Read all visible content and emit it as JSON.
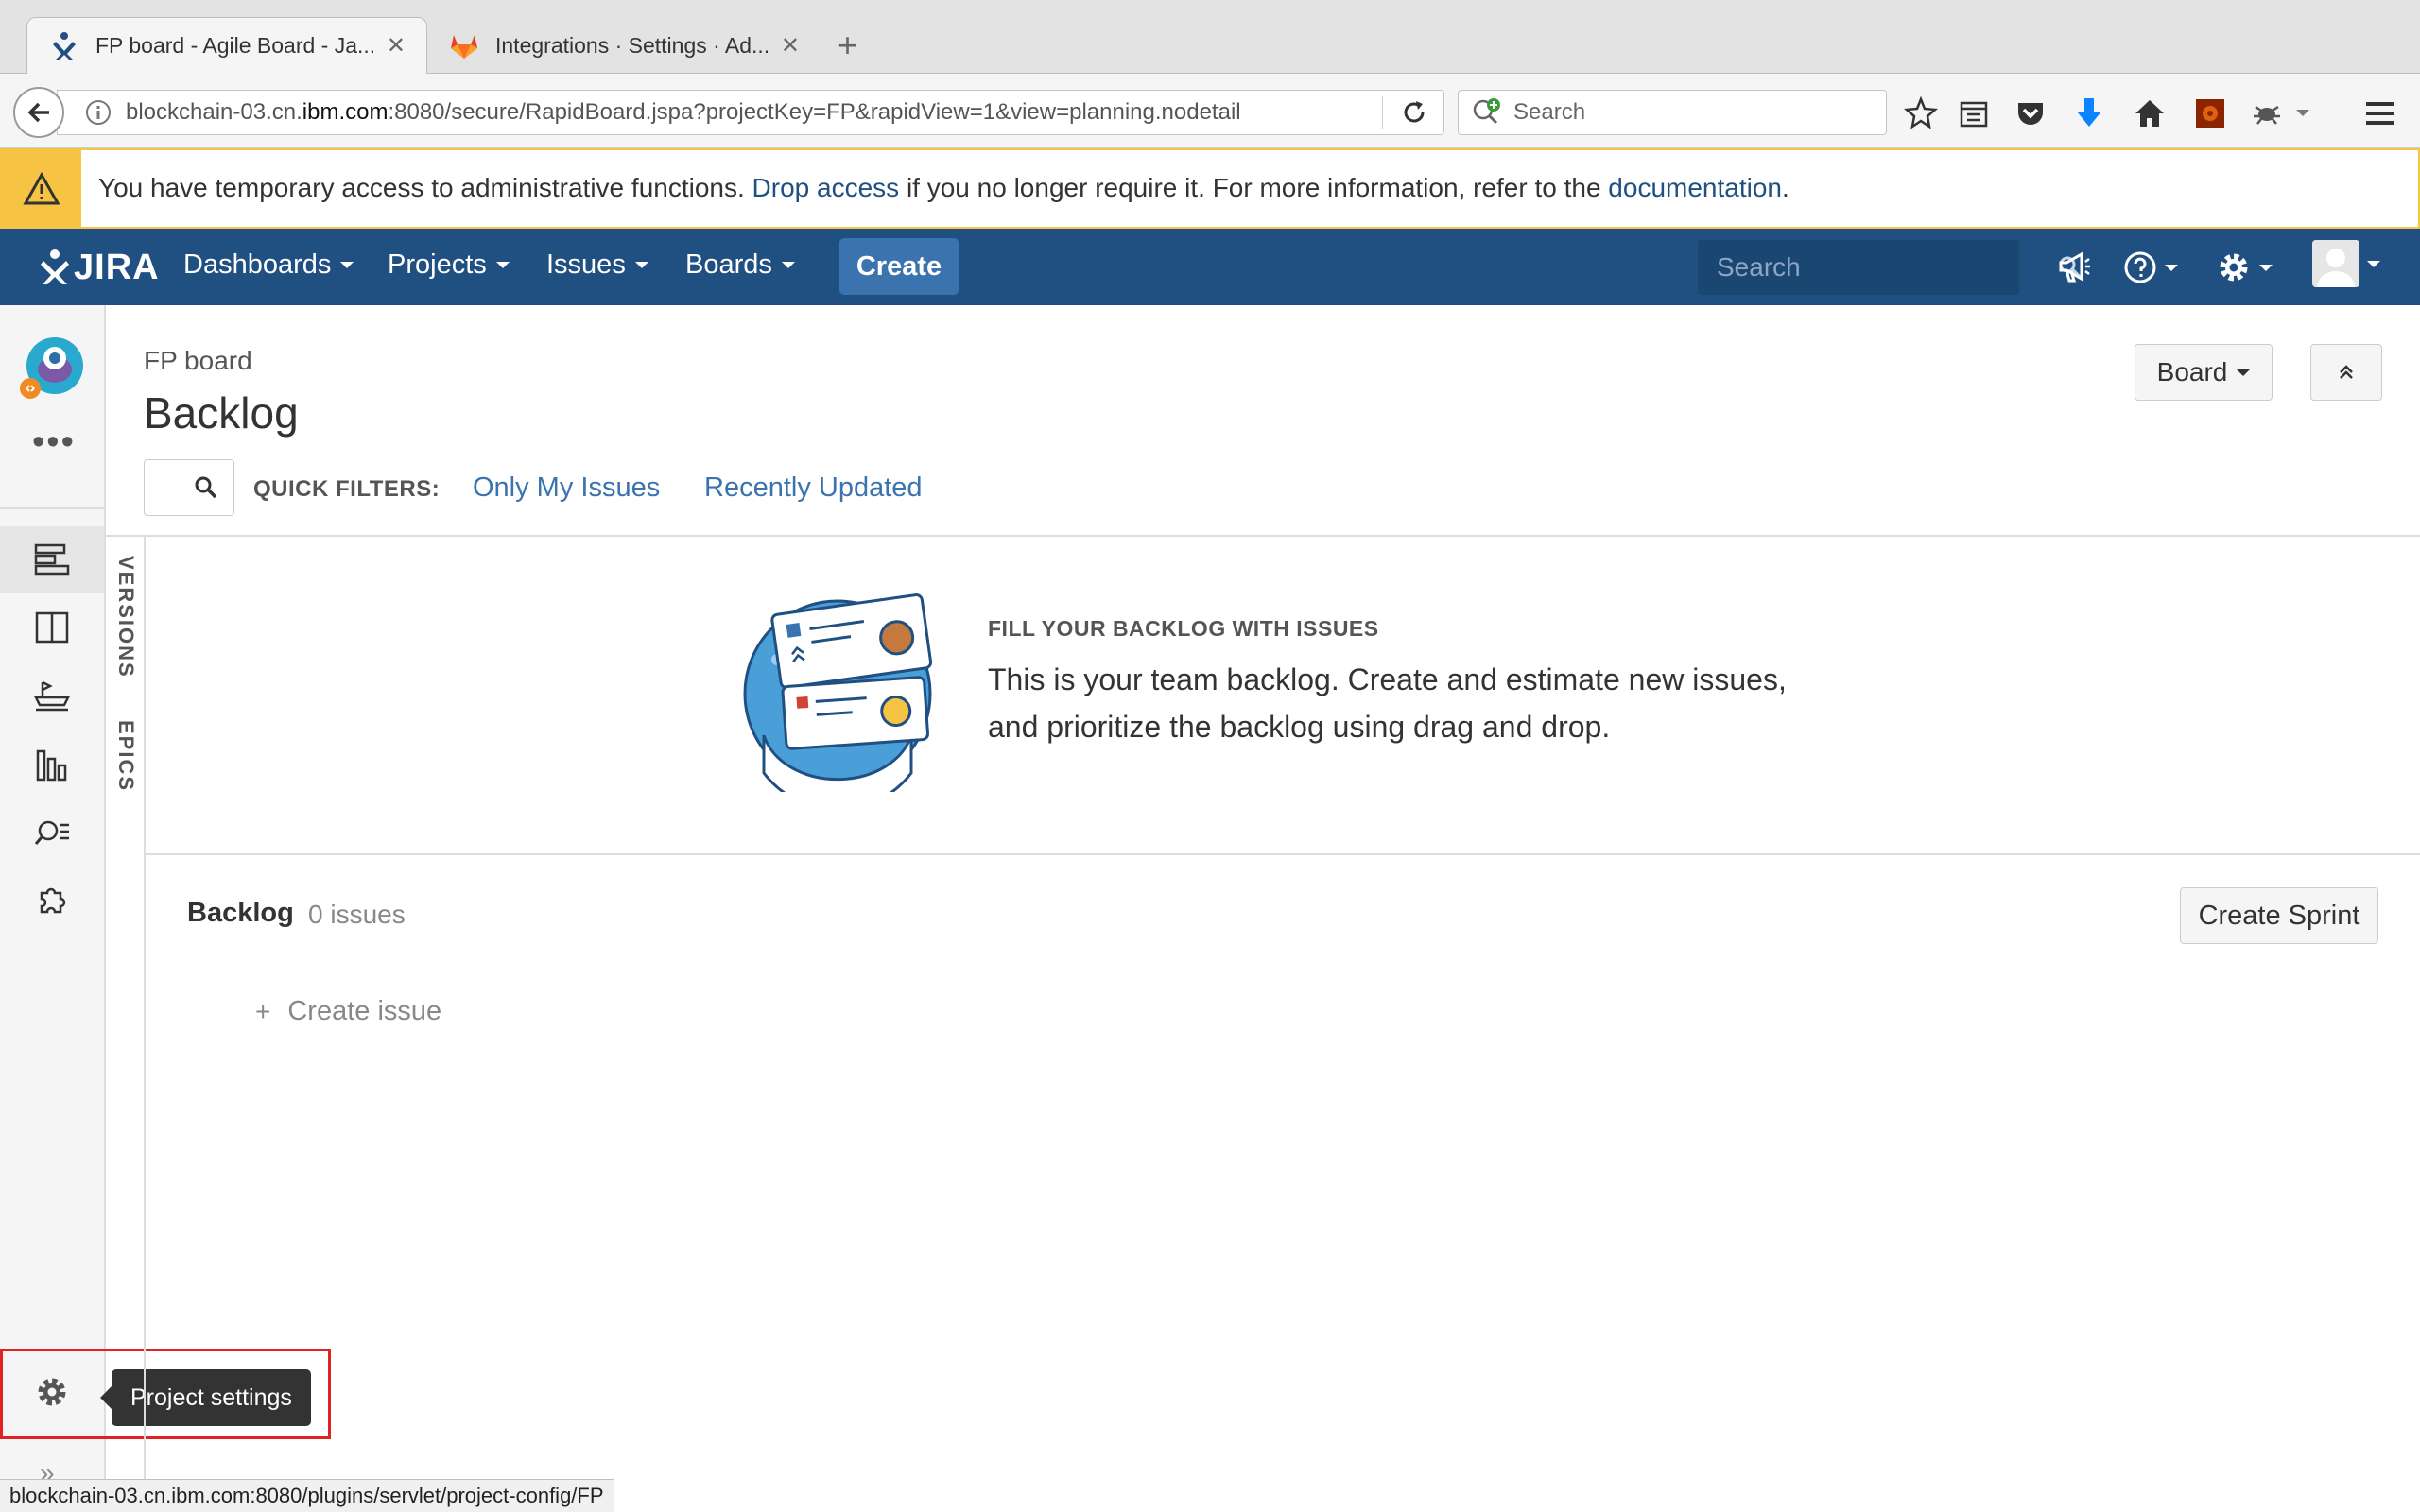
{
  "browser": {
    "tabs": [
      {
        "label": "FP board - Agile Board - Ja...",
        "active": true,
        "icon": "jira-icon"
      },
      {
        "label": "Integrations · Settings · Ad...",
        "active": false,
        "icon": "gitlab-icon"
      }
    ],
    "close_glyph": "✕",
    "new_tab_glyph": "+",
    "url_prefix": "blockchain-03.cn.",
    "url_host": "ibm.com",
    "url_rest": ":8080/secure/RapidBoard.jspa?projectKey=FP&rapidView=1&view=planning.nodetail",
    "search_placeholder": "Search",
    "status_url": "blockchain-03.cn.ibm.com:8080/plugins/servlet/project-config/FP"
  },
  "banner": {
    "text_before": "You have temporary access to administrative functions. ",
    "link_drop": "Drop access",
    "text_middle": " if you no longer require it. For more information, refer to the ",
    "link_docs": "documentation",
    "text_after": ".",
    "accent": "#f6c342"
  },
  "header": {
    "logo_text": "JIRA",
    "nav": [
      "Dashboards",
      "Projects",
      "Issues",
      "Boards"
    ],
    "create_label": "Create",
    "search_placeholder": "Search",
    "background": "#205081",
    "create_color": "#3b73af"
  },
  "sidebar": {
    "more": "•••",
    "items": [
      "backlog-icon",
      "active-sprints-icon",
      "releases-icon",
      "reports-icon",
      "issues-search-icon",
      "add-ons-icon"
    ],
    "settings_tooltip": "Project settings",
    "expand_glyph": "»"
  },
  "main": {
    "breadcrumb": "FP board",
    "title": "Backlog",
    "board_button": "Board",
    "quick_filters_label": "QUICK FILTERS:",
    "quick_filters": [
      "Only My Issues",
      "Recently Updated"
    ],
    "vertical_tabs": [
      "VERSIONS",
      "EPICS"
    ],
    "empty_heading": "FILL YOUR BACKLOG WITH ISSUES",
    "empty_line1": "This is your team backlog. Create and estimate new issues,",
    "empty_line2": "and prioritize the backlog using drag and drop.",
    "backlog_label": "Backlog",
    "backlog_count": "0 issues",
    "create_sprint": "Create Sprint",
    "create_issue": "Create issue",
    "plus_glyph": "+",
    "link_color": "#3b73af"
  }
}
